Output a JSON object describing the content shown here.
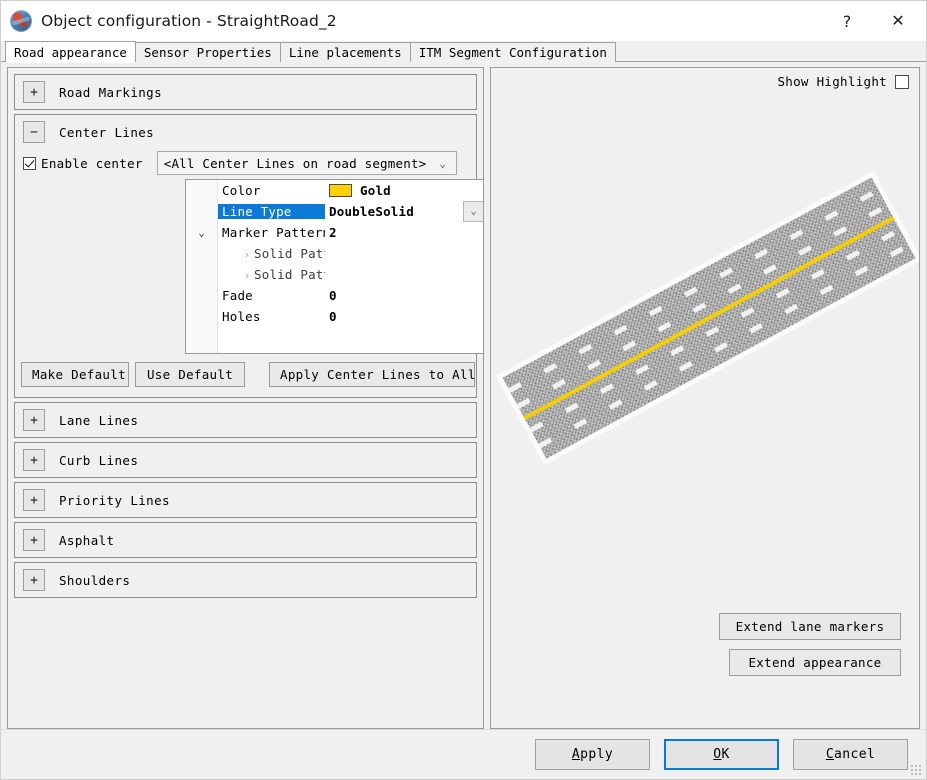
{
  "window": {
    "title": "Object configuration - StraightRoad_2",
    "icon": "app-globe-icon",
    "help_label": "?",
    "close_label": "✕"
  },
  "tabs": [
    {
      "label": "Road appearance",
      "active": true
    },
    {
      "label": "Sensor Properties",
      "active": false
    },
    {
      "label": "Line placements",
      "active": false
    },
    {
      "label": "ITM Segment Configuration",
      "active": false
    }
  ],
  "sections": [
    {
      "label": "Road Markings",
      "expander": "+",
      "expanded": false
    },
    {
      "label": "Center Lines",
      "expander": "−",
      "expanded": true
    },
    {
      "label": "Lane Lines",
      "expander": "+",
      "expanded": false
    },
    {
      "label": "Curb Lines",
      "expander": "+",
      "expanded": false
    },
    {
      "label": "Priority Lines",
      "expander": "+",
      "expanded": false
    },
    {
      "label": "Asphalt",
      "expander": "+",
      "expanded": false
    },
    {
      "label": "Shoulders",
      "expander": "+",
      "expanded": false
    }
  ],
  "center_lines": {
    "enable_label": "Enable center",
    "enable_checked": true,
    "selector_value": "<All Center Lines on road segment>",
    "selector_arrow": "⌄",
    "properties": [
      {
        "name": "Color",
        "value": "Gold",
        "swatch": "#ffd005",
        "twisty": "",
        "indent": 0,
        "selected": false,
        "dropdown": false
      },
      {
        "name": "Line Type",
        "value": "DoubleSolid",
        "swatch": "",
        "twisty": "",
        "indent": 0,
        "selected": true,
        "dropdown": true
      },
      {
        "name": "Marker Pattern",
        "value": "2",
        "swatch": "",
        "twisty": "⌄",
        "indent": 0,
        "selected": false,
        "dropdown": false
      },
      {
        "name": "Solid Patte",
        "value": "",
        "swatch": "",
        "twisty": "›",
        "indent": 1,
        "selected": false,
        "dropdown": false
      },
      {
        "name": "Solid Patte",
        "value": "",
        "swatch": "",
        "twisty": "›",
        "indent": 1,
        "selected": false,
        "dropdown": false
      },
      {
        "name": "Fade",
        "value": "0",
        "swatch": "",
        "twisty": "",
        "indent": 0,
        "selected": false,
        "dropdown": false
      },
      {
        "name": "Holes",
        "value": "0",
        "swatch": "",
        "twisty": "",
        "indent": 0,
        "selected": false,
        "dropdown": false
      }
    ],
    "buttons": {
      "make_default": "Make Default",
      "use_default": "Use Default",
      "apply_all": "Apply Center Lines to All"
    }
  },
  "preview": {
    "show_highlight_label": "Show Highlight",
    "show_highlight_checked": false,
    "road": {
      "center_line_color": "#f5cf00",
      "asphalt_color": "#b0b0b0",
      "marker_color": "#f2f2f2",
      "rotation_deg": -28.5
    },
    "extend_lane_markers": "Extend lane markers",
    "extend_appearance": "Extend appearance"
  },
  "footer": {
    "apply": {
      "pre": "",
      "accel": "A",
      "post": "pply"
    },
    "ok": {
      "pre": "",
      "accel": "O",
      "post": "K"
    },
    "cancel": {
      "pre": "",
      "accel": "C",
      "post": "ancel"
    }
  },
  "colors": {
    "selection_blue": "#0b7ad6",
    "gold": "#ffd005",
    "face": "#f0f0f0"
  }
}
